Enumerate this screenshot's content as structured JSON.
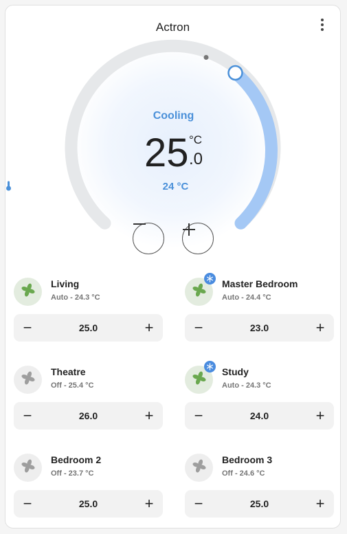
{
  "card": {
    "title": "Actron"
  },
  "thermostat": {
    "mode": "Cooling",
    "target_whole": "25",
    "target_decimal": ".0",
    "unit": "°C",
    "current_temp": "24 °C",
    "decrease_icon": "minus-icon",
    "increase_icon": "plus-icon"
  },
  "colors": {
    "accent": "#4a90d9",
    "arc_active": "#a4c8f5",
    "arc_track": "#e6e8ea",
    "fan_on": "#6aa84f",
    "fan_off": "#9e9e9e",
    "badge": "#4a8cdf"
  },
  "zones": [
    {
      "name": "Living",
      "status": "Auto - 24.3 °C",
      "setpoint": "25.0",
      "state": "on",
      "cooling_badge": false
    },
    {
      "name": "Master Bedroom",
      "status": "Auto - 24.4 °C",
      "setpoint": "23.0",
      "state": "on",
      "cooling_badge": true
    },
    {
      "name": "Theatre",
      "status": "Off - 25.4 °C",
      "setpoint": "26.0",
      "state": "off",
      "cooling_badge": false
    },
    {
      "name": "Study",
      "status": "Auto - 24.3 °C",
      "setpoint": "24.0",
      "state": "on",
      "cooling_badge": true
    },
    {
      "name": "Bedroom 2",
      "status": "Off - 23.7 °C",
      "setpoint": "25.0",
      "state": "off",
      "cooling_badge": false
    },
    {
      "name": "Bedroom 3",
      "status": "Off - 24.6 °C",
      "setpoint": "25.0",
      "state": "off",
      "cooling_badge": false
    }
  ],
  "stepper": {
    "minus": "−",
    "plus": "+"
  }
}
